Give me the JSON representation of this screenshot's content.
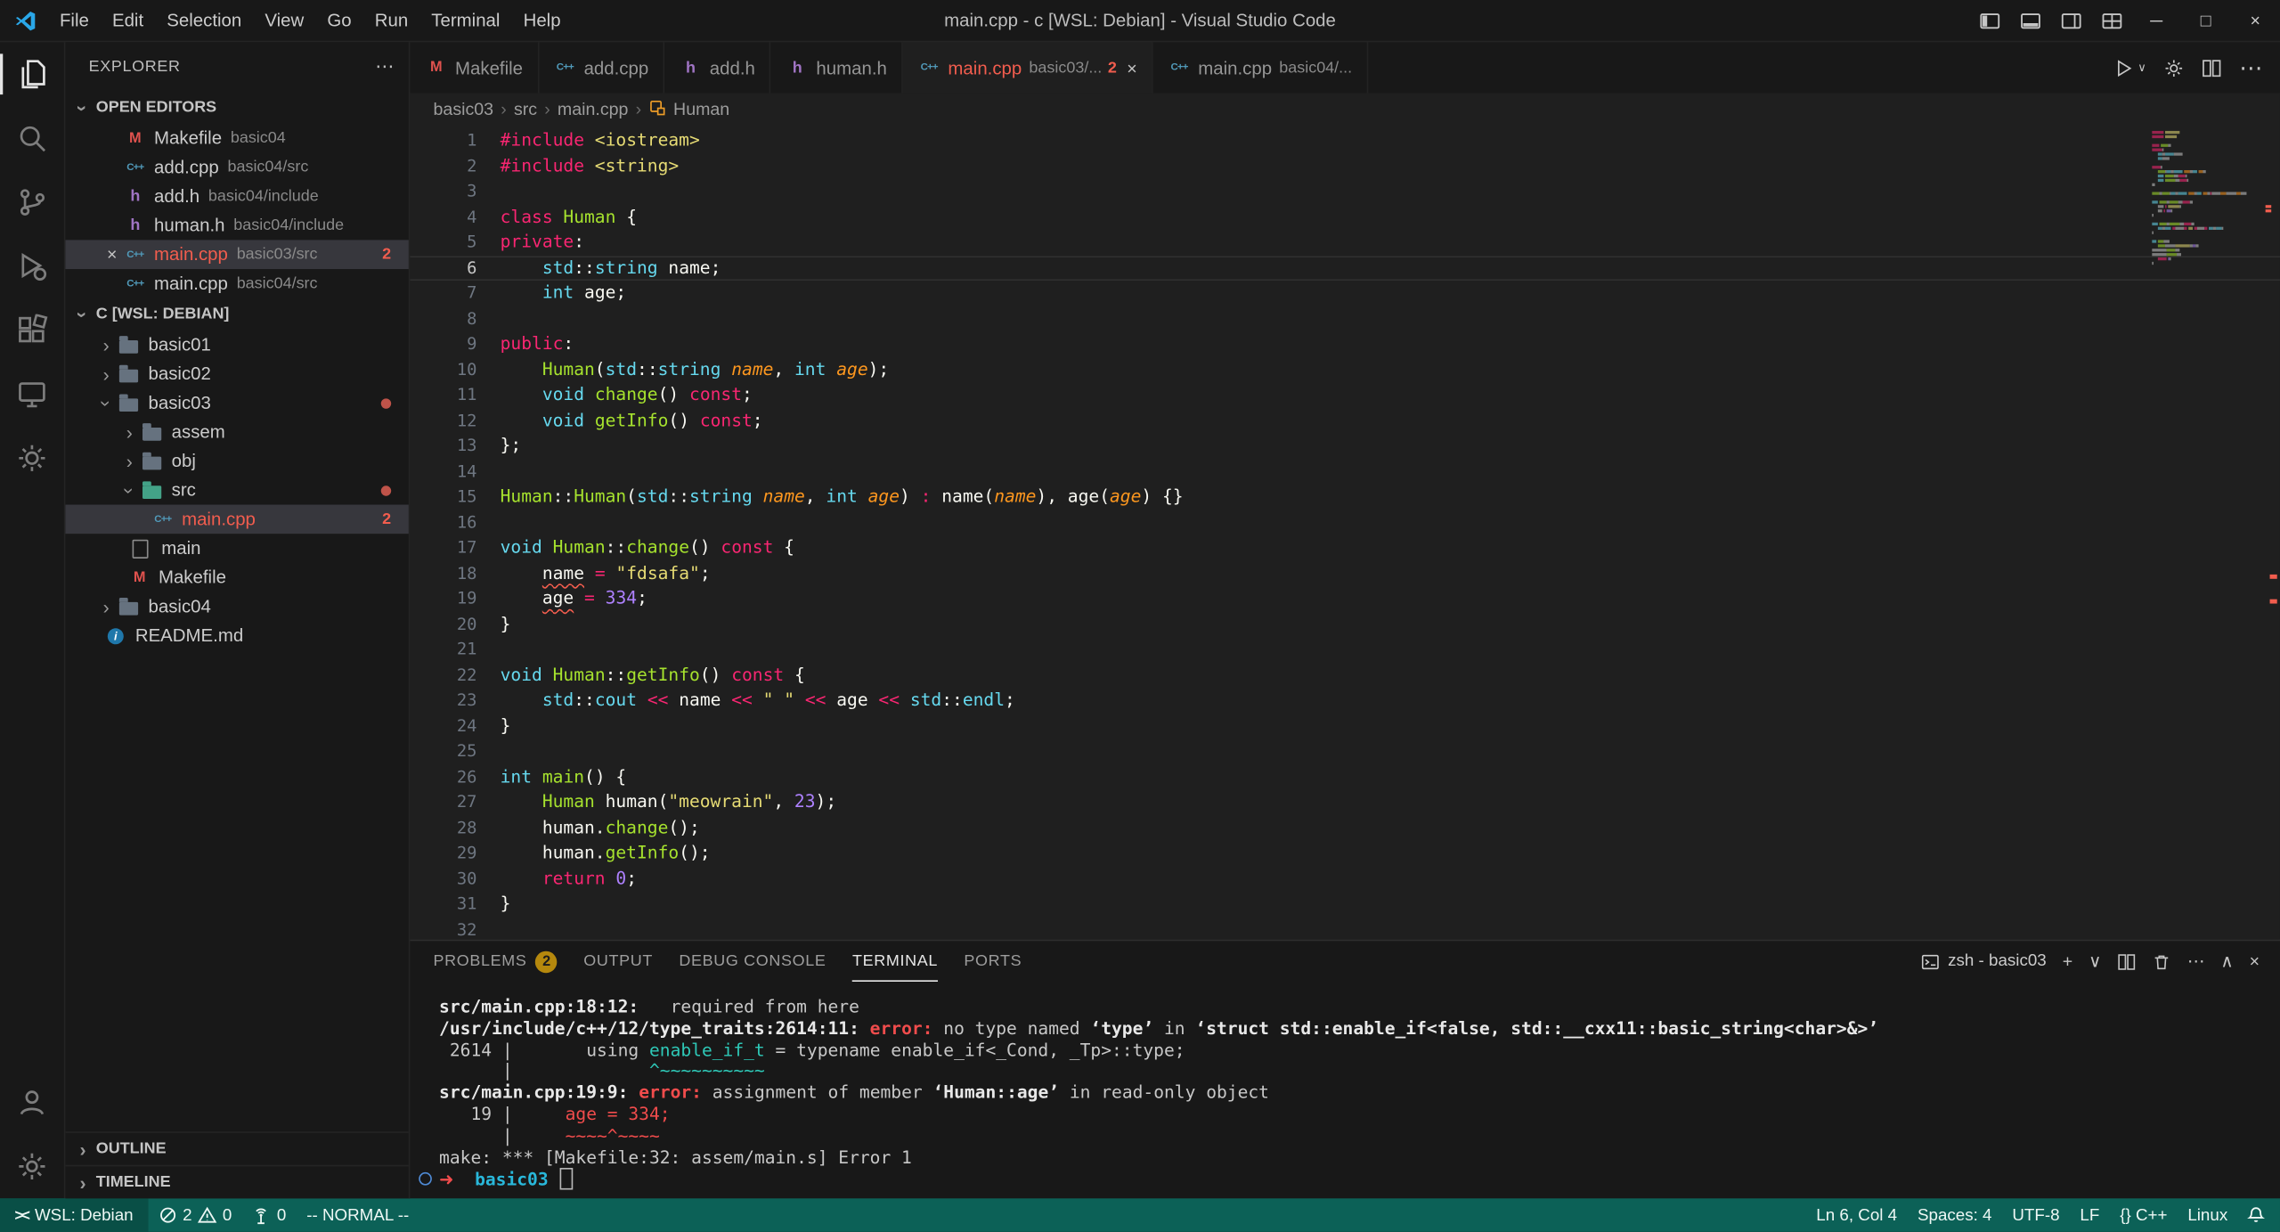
{
  "colors": {
    "accent_error": "#f25d4e",
    "status_bar": "#0c6157",
    "status_bar_remote": "#094f46",
    "badge": "#b5880d",
    "terminal_teal": "#2ec8b7",
    "terminal_cyan": "#29b8db"
  },
  "titlebar": {
    "menus": [
      "File",
      "Edit",
      "Selection",
      "View",
      "Go",
      "Run",
      "Terminal",
      "Help"
    ],
    "title": "main.cpp - c [WSL: Debian] - Visual Studio Code"
  },
  "sidebar": {
    "header": "EXPLORER",
    "open_editors": {
      "label": "OPEN EDITORS",
      "items": [
        {
          "file": "Makefile",
          "desc": "basic04",
          "icon": "makefile"
        },
        {
          "file": "add.cpp",
          "desc": "basic04/src",
          "icon": "cpp"
        },
        {
          "file": "add.h",
          "desc": "basic04/include",
          "icon": "header"
        },
        {
          "file": "human.h",
          "desc": "basic04/include",
          "icon": "header"
        },
        {
          "file": "main.cpp",
          "desc": "basic03/src",
          "icon": "cpp",
          "active": true,
          "error": true,
          "badge": "2"
        },
        {
          "file": "main.cpp",
          "desc": "basic04/src",
          "icon": "cpp"
        }
      ]
    },
    "workspace": {
      "label": "C [WSL: DEBIAN]",
      "items": [
        {
          "label": "basic01",
          "kind": "folder",
          "depth": 0
        },
        {
          "label": "basic02",
          "kind": "folder",
          "depth": 0
        },
        {
          "label": "basic03",
          "kind": "folder",
          "depth": 0,
          "expanded": true,
          "dot": true
        },
        {
          "label": "assem",
          "kind": "folder",
          "depth": 1
        },
        {
          "label": "obj",
          "kind": "folder",
          "depth": 1
        },
        {
          "label": "src",
          "kind": "folder",
          "depth": 1,
          "expanded": true,
          "dot": true,
          "accent": "teal"
        },
        {
          "label": "main.cpp",
          "kind": "file",
          "icon": "cpp",
          "depth": 2,
          "selected": true,
          "error": true,
          "badge": "2"
        },
        {
          "label": "main",
          "kind": "file",
          "icon": "file",
          "depth": 1
        },
        {
          "label": "Makefile",
          "kind": "file",
          "icon": "makefile",
          "depth": 1
        },
        {
          "label": "basic04",
          "kind": "folder",
          "depth": 0
        },
        {
          "label": "README.md",
          "kind": "file",
          "icon": "info",
          "depth": 0
        }
      ]
    },
    "footer_sections": [
      "OUTLINE",
      "TIMELINE"
    ]
  },
  "editor_tabs": [
    {
      "file": "Makefile",
      "icon": "makefile"
    },
    {
      "file": "add.cpp",
      "icon": "cpp"
    },
    {
      "file": "add.h",
      "icon": "header"
    },
    {
      "file": "human.h",
      "icon": "header"
    },
    {
      "file": "main.cpp",
      "icon": "cpp",
      "desc": "basic03/...",
      "badge": "2",
      "active": true,
      "error": true,
      "close": true
    },
    {
      "file": "main.cpp",
      "icon": "cpp",
      "desc": "basic04/..."
    }
  ],
  "breadcrumbs": [
    "basic03",
    "src",
    "main.cpp",
    "Human"
  ],
  "editor": {
    "active_line": 6,
    "error_lines": [
      18,
      19
    ],
    "lines": [
      [
        [
          "k",
          "#include"
        ],
        [
          "w",
          " "
        ],
        [
          "s",
          "<iostream>"
        ]
      ],
      [
        [
          "k",
          "#include"
        ],
        [
          "w",
          " "
        ],
        [
          "s",
          "<string>"
        ]
      ],
      [],
      [
        [
          "k",
          "class"
        ],
        [
          "w",
          " "
        ],
        [
          "g",
          "Human"
        ],
        [
          "w",
          " {"
        ]
      ],
      [
        [
          "k",
          "private"
        ],
        [
          "w",
          ":"
        ]
      ],
      [
        [
          "w",
          "    "
        ],
        [
          "t",
          "std"
        ],
        [
          "w",
          "::"
        ],
        [
          "t",
          "string"
        ],
        [
          "w",
          " name;"
        ]
      ],
      [
        [
          "w",
          "    "
        ],
        [
          "t",
          "int"
        ],
        [
          "w",
          " age;"
        ]
      ],
      [],
      [
        [
          "k",
          "public"
        ],
        [
          "w",
          ":"
        ]
      ],
      [
        [
          "w",
          "    "
        ],
        [
          "g",
          "Human"
        ],
        [
          "w",
          "("
        ],
        [
          "t",
          "std"
        ],
        [
          "w",
          "::"
        ],
        [
          "t",
          "string"
        ],
        [
          "w",
          " "
        ],
        [
          "o",
          "name"
        ],
        [
          "w",
          ", "
        ],
        [
          "t",
          "int"
        ],
        [
          "w",
          " "
        ],
        [
          "o",
          "age"
        ],
        [
          "w",
          ");"
        ]
      ],
      [
        [
          "w",
          "    "
        ],
        [
          "t",
          "void"
        ],
        [
          "w",
          " "
        ],
        [
          "g",
          "change"
        ],
        [
          "w",
          "() "
        ],
        [
          "k",
          "const"
        ],
        [
          "w",
          ";"
        ]
      ],
      [
        [
          "w",
          "    "
        ],
        [
          "t",
          "void"
        ],
        [
          "w",
          " "
        ],
        [
          "g",
          "getInfo"
        ],
        [
          "w",
          "() "
        ],
        [
          "k",
          "const"
        ],
        [
          "w",
          ";"
        ]
      ],
      [
        [
          "w",
          "};"
        ]
      ],
      [],
      [
        [
          "g",
          "Human"
        ],
        [
          "w",
          "::"
        ],
        [
          "g",
          "Human"
        ],
        [
          "w",
          "("
        ],
        [
          "t",
          "std"
        ],
        [
          "w",
          "::"
        ],
        [
          "t",
          "string"
        ],
        [
          "w",
          " "
        ],
        [
          "o",
          "name"
        ],
        [
          "w",
          ", "
        ],
        [
          "t",
          "int"
        ],
        [
          "w",
          " "
        ],
        [
          "o",
          "age"
        ],
        [
          "w",
          ") "
        ],
        [
          "k",
          ":"
        ],
        [
          "w",
          " name("
        ],
        [
          "o",
          "name"
        ],
        [
          "w",
          "), age("
        ],
        [
          "o",
          "age"
        ],
        [
          "w",
          ") {}"
        ]
      ],
      [],
      [
        [
          "t",
          "void"
        ],
        [
          "w",
          " "
        ],
        [
          "g",
          "Human"
        ],
        [
          "w",
          "::"
        ],
        [
          "g",
          "change"
        ],
        [
          "w",
          "() "
        ],
        [
          "k",
          "const"
        ],
        [
          "w",
          " {"
        ]
      ],
      [
        [
          "w",
          "    "
        ],
        [
          "sq",
          "name"
        ],
        [
          "w",
          " "
        ],
        [
          "k",
          "="
        ],
        [
          "w",
          " "
        ],
        [
          "s",
          "\"fdsafa\""
        ],
        [
          "w",
          ";"
        ]
      ],
      [
        [
          "w",
          "    "
        ],
        [
          "sq",
          "age"
        ],
        [
          "w",
          " "
        ],
        [
          "k",
          "="
        ],
        [
          "w",
          " "
        ],
        [
          "n",
          "334"
        ],
        [
          "w",
          ";"
        ]
      ],
      [
        [
          "w",
          "}"
        ]
      ],
      [],
      [
        [
          "t",
          "void"
        ],
        [
          "w",
          " "
        ],
        [
          "g",
          "Human"
        ],
        [
          "w",
          "::"
        ],
        [
          "g",
          "getInfo"
        ],
        [
          "w",
          "() "
        ],
        [
          "k",
          "const"
        ],
        [
          "w",
          " {"
        ]
      ],
      [
        [
          "w",
          "    "
        ],
        [
          "t",
          "std"
        ],
        [
          "w",
          "::"
        ],
        [
          "t",
          "cout"
        ],
        [
          "w",
          " "
        ],
        [
          "k",
          "<<"
        ],
        [
          "w",
          " name "
        ],
        [
          "k",
          "<<"
        ],
        [
          "w",
          " "
        ],
        [
          "s",
          "\" \""
        ],
        [
          "w",
          " "
        ],
        [
          "k",
          "<<"
        ],
        [
          "w",
          " age "
        ],
        [
          "k",
          "<<"
        ],
        [
          "w",
          " "
        ],
        [
          "t",
          "std"
        ],
        [
          "w",
          "::"
        ],
        [
          "t",
          "endl"
        ],
        [
          "w",
          ";"
        ]
      ],
      [
        [
          "w",
          "}"
        ]
      ],
      [],
      [
        [
          "t",
          "int"
        ],
        [
          "w",
          " "
        ],
        [
          "g",
          "main"
        ],
        [
          "w",
          "() {"
        ]
      ],
      [
        [
          "w",
          "    "
        ],
        [
          "g",
          "Human"
        ],
        [
          "w",
          " human("
        ],
        [
          "s",
          "\"meowrain\""
        ],
        [
          "w",
          ", "
        ],
        [
          "n",
          "23"
        ],
        [
          "w",
          ");"
        ]
      ],
      [
        [
          "w",
          "    human."
        ],
        [
          "g",
          "change"
        ],
        [
          "w",
          "();"
        ]
      ],
      [
        [
          "w",
          "    human."
        ],
        [
          "g",
          "getInfo"
        ],
        [
          "w",
          "();"
        ]
      ],
      [
        [
          "w",
          "    "
        ],
        [
          "k",
          "return"
        ],
        [
          "w",
          " "
        ],
        [
          "n",
          "0"
        ],
        [
          "w",
          ";"
        ]
      ],
      [
        [
          "w",
          "}"
        ]
      ],
      []
    ]
  },
  "panel": {
    "tabs": [
      {
        "label": "PROBLEMS",
        "badge": "2"
      },
      {
        "label": "OUTPUT"
      },
      {
        "label": "DEBUG CONSOLE"
      },
      {
        "label": "TERMINAL",
        "active": true
      },
      {
        "label": "PORTS"
      }
    ],
    "shell_label": "zsh - basic03"
  },
  "terminal": {
    "lines": [
      {
        "tokens": [
          [
            "b",
            "src/main.cpp:18:12:"
          ],
          [
            "w",
            "   required from here"
          ]
        ]
      },
      {
        "tokens": [
          [
            "b",
            "/usr/include/c++/12/type_traits:2614:11:"
          ],
          [
            "w",
            " "
          ],
          [
            "err",
            "error:"
          ],
          [
            "w",
            " no type named "
          ],
          [
            "b",
            "‘type’"
          ],
          [
            "w",
            " in "
          ],
          [
            "b",
            "‘struct std::enable_if<false, std::__cxx11::basic_string<char>&>’"
          ]
        ]
      },
      {
        "tokens": [
          [
            "w",
            " 2614 |       using "
          ],
          [
            "teal",
            "enable_if_t"
          ],
          [
            "w",
            " = typename enable_if<_Cond, _Tp>::type;"
          ]
        ]
      },
      {
        "tokens": [
          [
            "w",
            "      |             "
          ],
          [
            "teal",
            "^~~~~~~~~~~"
          ]
        ]
      },
      {
        "tokens": [
          [
            "b",
            "src/main.cpp:19:9:"
          ],
          [
            "w",
            " "
          ],
          [
            "err",
            "error:"
          ],
          [
            "w",
            " assignment of member "
          ],
          [
            "b",
            "‘Human::age’"
          ],
          [
            "w",
            " in read-only object"
          ]
        ]
      },
      {
        "tokens": [
          [
            "w",
            "   19 |     "
          ],
          [
            "red",
            "age = 334;"
          ]
        ]
      },
      {
        "tokens": [
          [
            "w",
            "      |     "
          ],
          [
            "red",
            "~~~~^~~~~"
          ]
        ]
      },
      {
        "tokens": [
          [
            "w",
            "make: *** [Makefile:32: assem/main.s] Error 1"
          ]
        ]
      },
      {
        "tokens": [
          [
            "arrow",
            "➜"
          ],
          [
            "w",
            "  "
          ],
          [
            "cyan",
            "basic03"
          ],
          [
            "cursor",
            ""
          ]
        ],
        "prompt": true
      }
    ]
  },
  "statusbar": {
    "remote": "WSL: Debian",
    "errors": "2",
    "warnings": "0",
    "ports": "0",
    "mode": "-- NORMAL --",
    "right": [
      "Ln 6, Col 4",
      "Spaces: 4",
      "UTF-8",
      "LF",
      "{} C++",
      "Linux"
    ]
  }
}
